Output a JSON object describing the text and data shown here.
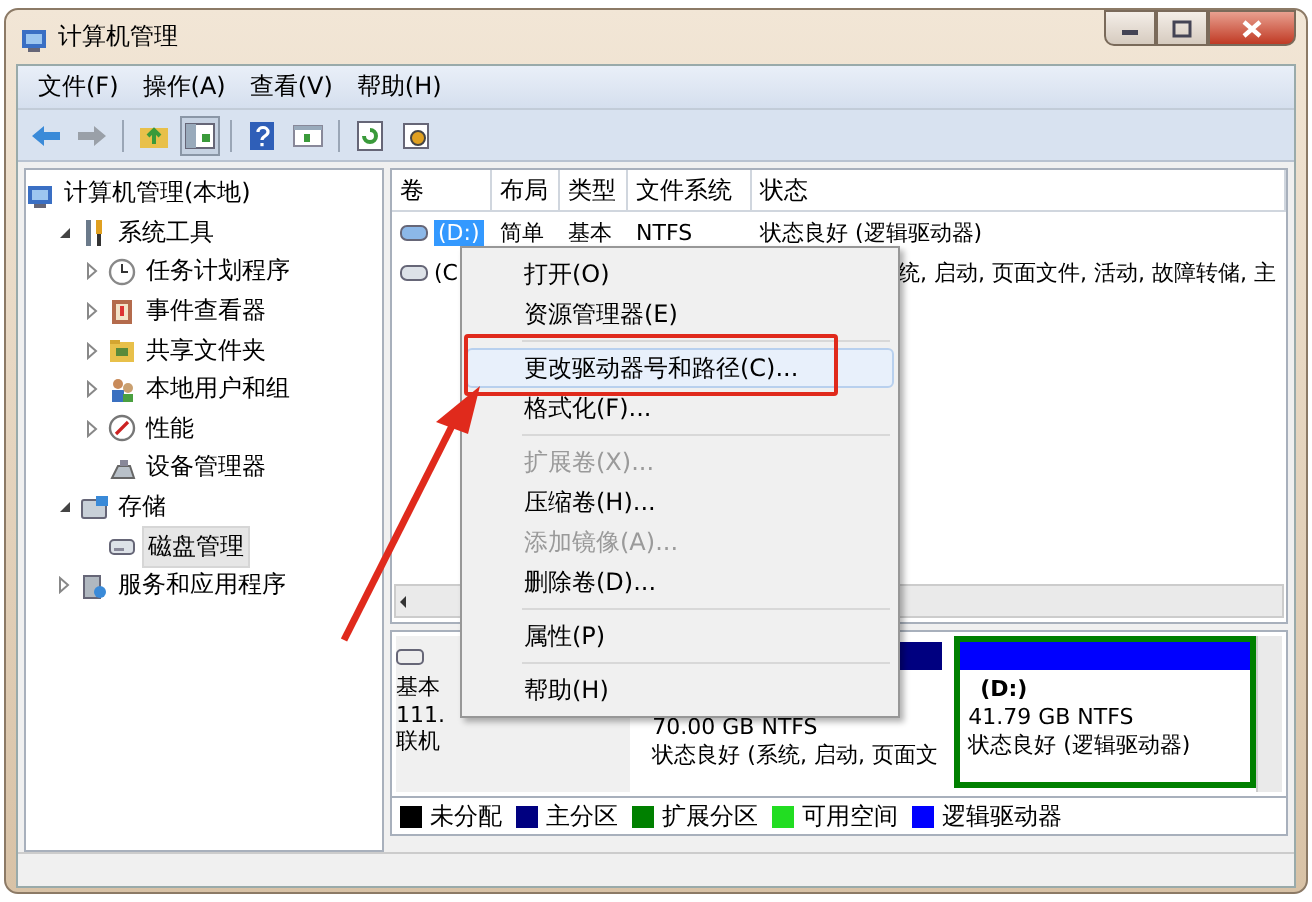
{
  "window": {
    "title": "计算机管理"
  },
  "menu_bar": [
    "文件(F)",
    "操作(A)",
    "查看(V)",
    "帮助(H)"
  ],
  "tree": {
    "label": "计算机管理(本地)",
    "selected": false,
    "children": [
      {
        "label": "系统工具",
        "expanded": true,
        "selected": false,
        "children": [
          {
            "label": "任务计划程序",
            "expanded": false,
            "selected": false
          },
          {
            "label": "事件查看器",
            "expanded": false,
            "selected": false
          },
          {
            "label": "共享文件夹",
            "expanded": false,
            "selected": false
          },
          {
            "label": "本地用户和组",
            "expanded": false,
            "selected": false
          },
          {
            "label": "性能",
            "expanded": false,
            "selected": false
          },
          {
            "label": "设备管理器",
            "selected": false
          }
        ]
      },
      {
        "label": "存储",
        "expanded": true,
        "selected": false,
        "children": [
          {
            "label": "磁盘管理",
            "selected": true
          }
        ]
      },
      {
        "label": "服务和应用程序",
        "expanded": false,
        "selected": false
      }
    ]
  },
  "volume_table": {
    "columns": [
      "卷",
      "布局",
      "类型",
      "文件系统",
      "状态"
    ],
    "rows": [
      {
        "selected": true,
        "volume": "(D:)",
        "layout": "简单",
        "type": "基本",
        "file_system": "NTFS",
        "status": "状态良好 (逻辑驱动器)"
      },
      {
        "selected": false,
        "volume": "(C",
        "status": "统, 启动, 页面文件, 活动, 故障转储, 主"
      }
    ]
  },
  "disk": {
    "lines": [
      "基本",
      "111.",
      "联机"
    ],
    "partitions": [
      {
        "kind": "primary",
        "color": "#000080",
        "size": "70.00 GB NTFS",
        "status": "状态良好 (系统, 启动, 页面文"
      },
      {
        "kind": "logical",
        "color": "#0000ff",
        "name": "(D:)",
        "size": "41.79 GB NTFS",
        "status": "状态良好 (逻辑驱动器)"
      }
    ]
  },
  "legend": [
    {
      "label": "未分配",
      "color": "#000000"
    },
    {
      "label": "主分区",
      "color": "#000080"
    },
    {
      "label": "扩展分区",
      "color": "#008000"
    },
    {
      "label": "可用空间",
      "color": "#22dd22"
    },
    {
      "label": "逻辑驱动器",
      "color": "#0000ff"
    }
  ],
  "context_menu": [
    {
      "kind": "item",
      "label": "打开(O)",
      "disabled": false,
      "selected": false
    },
    {
      "kind": "item",
      "label": "资源管理器(E)",
      "disabled": false,
      "selected": false
    },
    {
      "kind": "separator"
    },
    {
      "kind": "item",
      "label": "更改驱动器号和路径(C)...",
      "disabled": false,
      "selected": true
    },
    {
      "kind": "item",
      "label": "格式化(F)...",
      "disabled": false,
      "selected": false
    },
    {
      "kind": "separator"
    },
    {
      "kind": "item",
      "label": "扩展卷(X)...",
      "disabled": true,
      "selected": false
    },
    {
      "kind": "item",
      "label": "压缩卷(H)...",
      "disabled": false,
      "selected": false
    },
    {
      "kind": "item",
      "label": "添加镜像(A)...",
      "disabled": true,
      "selected": false
    },
    {
      "kind": "item",
      "label": "删除卷(D)...",
      "disabled": false,
      "selected": false
    },
    {
      "kind": "separator"
    },
    {
      "kind": "item",
      "label": "属性(P)",
      "disabled": false,
      "selected": false
    },
    {
      "kind": "separator"
    },
    {
      "kind": "item",
      "label": "帮助(H)",
      "disabled": false,
      "selected": false
    }
  ]
}
